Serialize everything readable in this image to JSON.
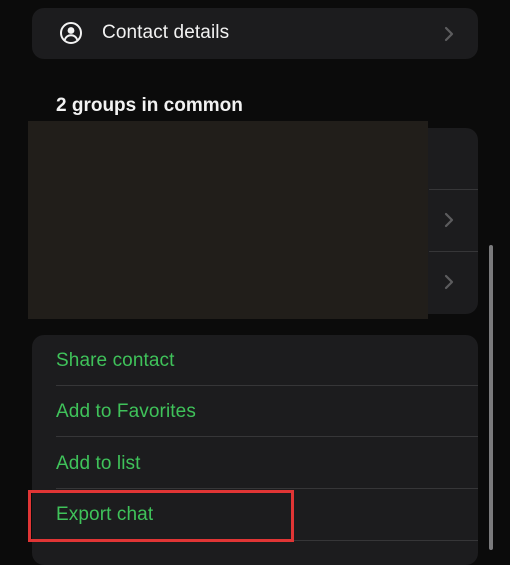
{
  "contact_row": {
    "label": "Contact details",
    "icon": "person-circle-icon",
    "chevron": "chevron-right-icon"
  },
  "groups": {
    "heading": "2 groups in common"
  },
  "actions": {
    "items": [
      {
        "label": "Share contact"
      },
      {
        "label": "Add to Favorites"
      },
      {
        "label": "Add to list"
      },
      {
        "label": "Export chat"
      }
    ]
  },
  "colors": {
    "background": "#0b0b0b",
    "card": "#1c1c1e",
    "accent_green": "#3fc25a",
    "highlight_red": "#e03535",
    "text_primary": "#f2f2f2",
    "chevron": "#5c5c5e"
  }
}
